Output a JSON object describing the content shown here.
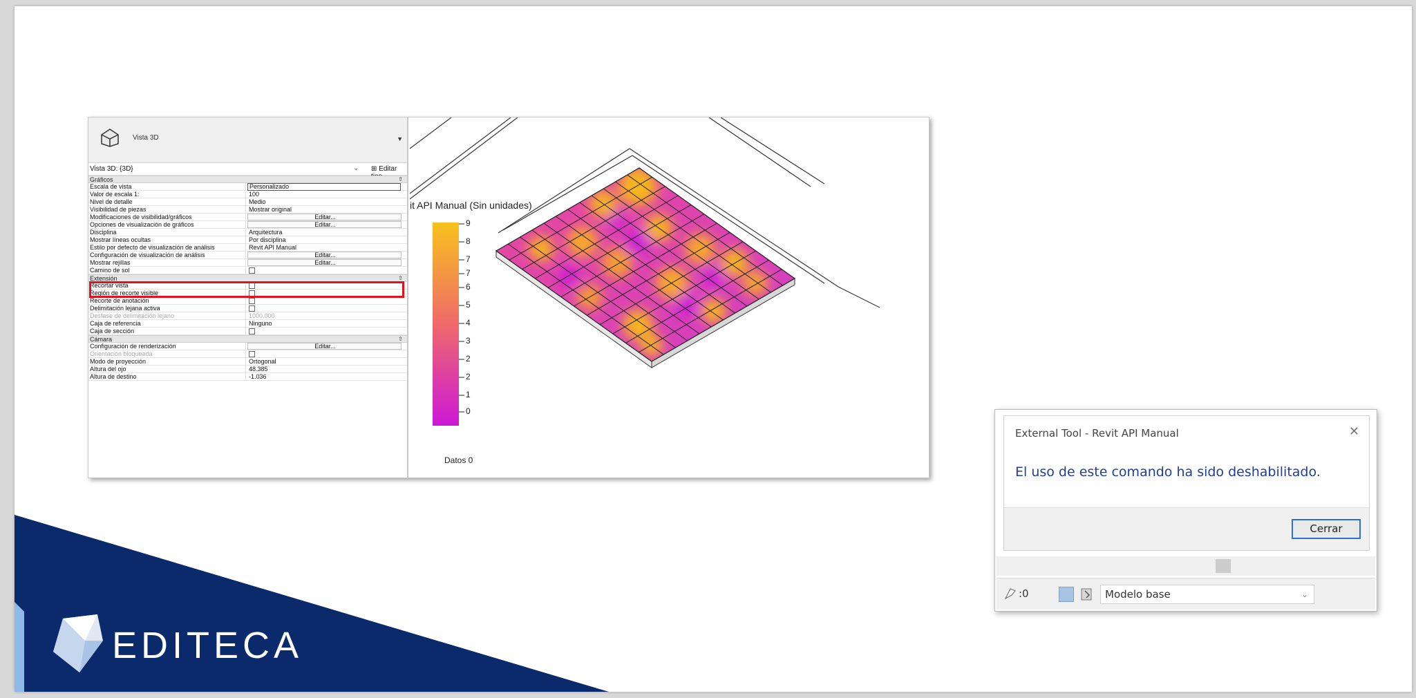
{
  "brand": {
    "name": "EDITECA",
    "colors": {
      "navy": "#0b2a6b",
      "light_blue": "#8fb9e8"
    }
  },
  "properties": {
    "header_label": "Vista 3D",
    "selector": "Vista 3D: {3D}",
    "edit_type": "Editar tipo",
    "groups": {
      "graficos": "Gráficos",
      "extension": "Extensión",
      "camara": "Cámara"
    },
    "rows": {
      "r1": {
        "k": "Escala de vista",
        "v": "Personalizado"
      },
      "r2": {
        "k": "Valor de escala    1:",
        "v": "100"
      },
      "r3": {
        "k": "Nivel de detalle",
        "v": "Medio"
      },
      "r4": {
        "k": "Visibilidad de piezas",
        "v": "Mostrar original"
      },
      "r5": {
        "k": "Modificaciones de visibilidad/gráficos",
        "v": "Editar..."
      },
      "r6": {
        "k": "Opciones de visualización de gráficos",
        "v": "Editar..."
      },
      "r7": {
        "k": "Disciplina",
        "v": "Arquitectura"
      },
      "r8": {
        "k": "Mostrar líneas ocultas",
        "v": "Por disciplina"
      },
      "r9": {
        "k": "Estilo por defecto de visualización de análisis",
        "v": "Revit API Manual"
      },
      "r10": {
        "k": "Configuración de visualización de análisis",
        "v": "Editar..."
      },
      "r11": {
        "k": "Mostrar rejillas",
        "v": "Editar..."
      },
      "r12": {
        "k": "Camino de sol",
        "v": ""
      },
      "e1": {
        "k": "Recortar vista",
        "v": ""
      },
      "e2": {
        "k": "Región de recorte visible",
        "v": ""
      },
      "e3": {
        "k": "Recorte de anotación",
        "v": ""
      },
      "e4": {
        "k": "Delimitación lejana activa",
        "v": ""
      },
      "e5": {
        "k": "Desfase de delimitación lejano",
        "v": "1000.000"
      },
      "e6": {
        "k": "Caja de referencia",
        "v": "Ninguno"
      },
      "e7": {
        "k": "Caja de sección",
        "v": ""
      },
      "c1": {
        "k": "Configuración de renderización",
        "v": "Editar..."
      },
      "c2": {
        "k": "Orientación bloqueada",
        "v": ""
      },
      "c3": {
        "k": "Modo de proyección",
        "v": "Ortogonal"
      },
      "c4": {
        "k": "Altura del ojo",
        "v": "48.385"
      },
      "c5": {
        "k": "Altura de destino",
        "v": "-1.036"
      }
    }
  },
  "legend": {
    "title": "it API Manual (Sin unidades)",
    "ticks": [
      "9",
      "8",
      "7",
      "7",
      "6",
      "5",
      "4",
      "3",
      "2",
      "2",
      "1",
      "0"
    ],
    "footer": "Datos 0"
  },
  "dialog": {
    "title": "External Tool - Revit API Manual",
    "message": "El uso de este comando ha sido deshabilitado.",
    "button": "Cerrar",
    "status_count": ":0",
    "status_select": "Modelo base"
  }
}
